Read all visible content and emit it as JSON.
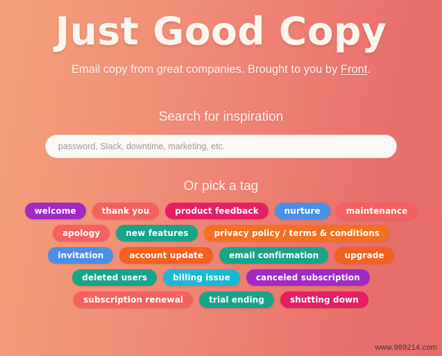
{
  "header": {
    "title": "Just Good Copy",
    "subtitle_before": "Email copy from great companies. Brought to you by ",
    "subtitle_link": "Front",
    "subtitle_after": "."
  },
  "search": {
    "heading": "Search for inspiration",
    "placeholder": "password, Slack, downtime, marketing, etc.",
    "value": ""
  },
  "tags": {
    "heading": "Or pick a tag",
    "rows": [
      [
        {
          "label": "welcome",
          "color": "#a02ac4"
        },
        {
          "label": "thank you",
          "color": "#f4615e"
        },
        {
          "label": "product feedback",
          "color": "#e51f63"
        },
        {
          "label": "nurture",
          "color": "#4a8fe8"
        },
        {
          "label": "maintenance",
          "color": "#f4615e"
        }
      ],
      [
        {
          "label": "apology",
          "color": "#f4615e"
        },
        {
          "label": "new features",
          "color": "#17a589"
        },
        {
          "label": "privacy policy / terms & conditions",
          "color": "#f4701f"
        }
      ],
      [
        {
          "label": "invitation",
          "color": "#4a8fe8"
        },
        {
          "label": "account update",
          "color": "#f4601f"
        },
        {
          "label": "email confirmation",
          "color": "#17a589"
        },
        {
          "label": "upgrade",
          "color": "#f4601f"
        }
      ],
      [
        {
          "label": "deleted users",
          "color": "#17a589"
        },
        {
          "label": "billing issue",
          "color": "#1bb8d4"
        },
        {
          "label": "canceled subscription",
          "color": "#a02ac4"
        }
      ],
      [
        {
          "label": "subscription renewal",
          "color": "#f4615e"
        },
        {
          "label": "trial ending",
          "color": "#17a589"
        },
        {
          "label": "shutting down",
          "color": "#e51f63"
        }
      ]
    ]
  },
  "watermark": {
    "text": "www.989214.com"
  },
  "theme": {
    "gradient_start": "#f4a07c",
    "gradient_end": "#e76c6a",
    "text_on_gradient": "#fdf3ee",
    "input_background": "#fbf8f5"
  }
}
